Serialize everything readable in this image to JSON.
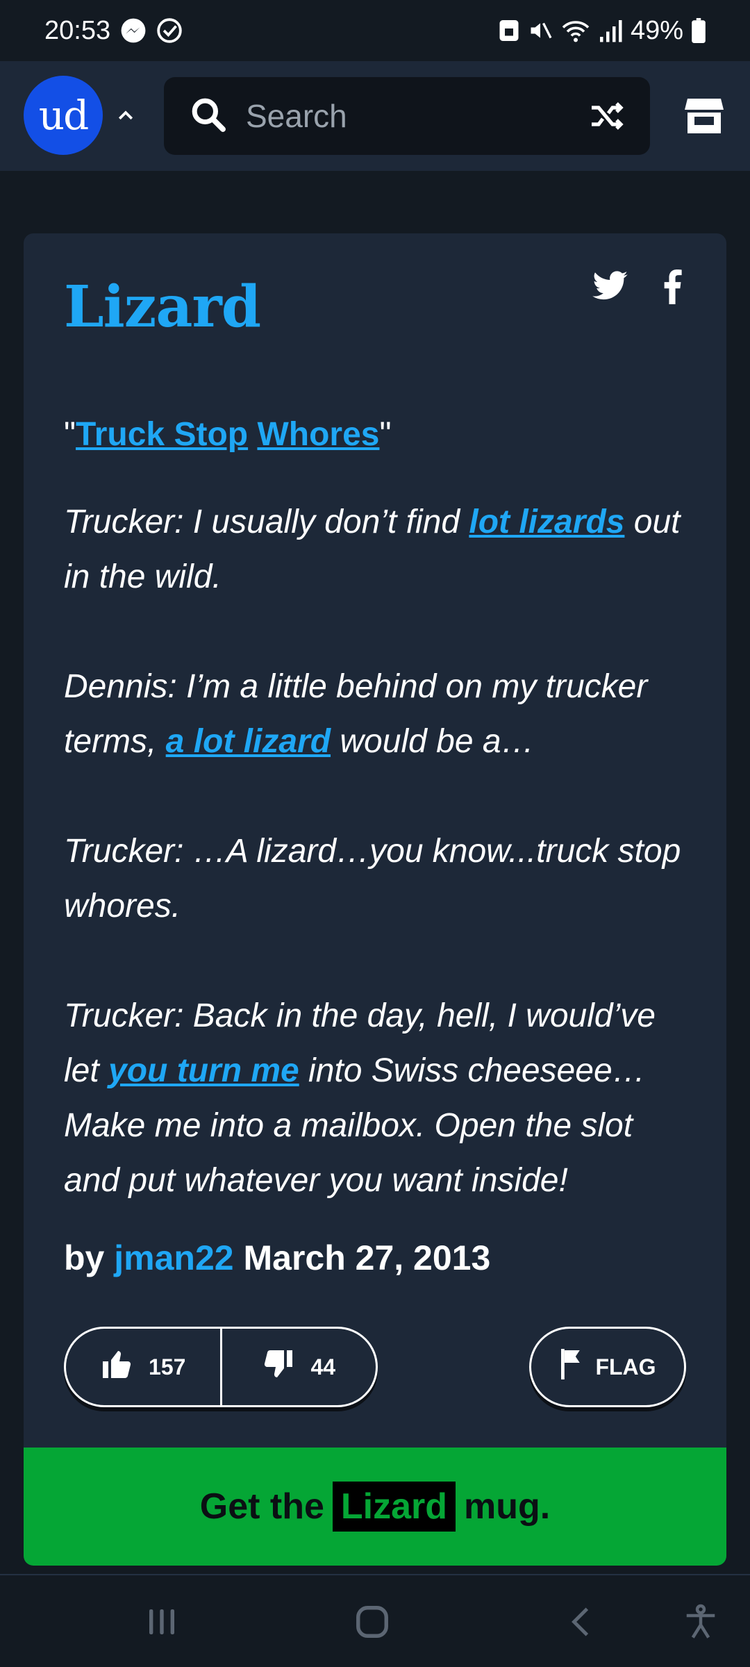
{
  "status_bar": {
    "time": "20:53",
    "battery": "49%"
  },
  "header": {
    "logo_text": "ud",
    "search_placeholder": "Search"
  },
  "entry": {
    "word": "Lizard",
    "definition": {
      "open_quote": "\"",
      "link_1": "Truck Stop",
      "space": " ",
      "link_2": "Whores",
      "close_quote": "\""
    },
    "example": [
      {
        "before": "Trucker: I usually don’t find ",
        "link": "lot lizards",
        "after": " out in the wild."
      },
      {
        "before": "Dennis: I’m a little behind on my trucker terms, ",
        "link": "a lot lizard",
        "after": " would be a…"
      },
      {
        "before": "Trucker: …A lizard…you know...truck stop whores.",
        "link": "",
        "after": ""
      },
      {
        "before": "Trucker: Back in the day, hell, I would’ve let ",
        "link": "you turn me",
        "after": " into Swiss cheeseee… Make me into a mailbox. Open the slot and put whatever you want inside!"
      }
    ],
    "by_label": "by",
    "author": "jman22",
    "date": "March 27, 2013",
    "upvotes": "157",
    "downvotes": "44",
    "flag_label": "FLAG",
    "mug": {
      "prefix": "Get the",
      "word": "Lizard",
      "suffix": "mug."
    }
  },
  "colors": {
    "accent": "#1fa7f5",
    "background": "#131a22",
    "card": "#1d2838",
    "mug_green": "#05a635",
    "logo_blue": "#134fe6"
  }
}
